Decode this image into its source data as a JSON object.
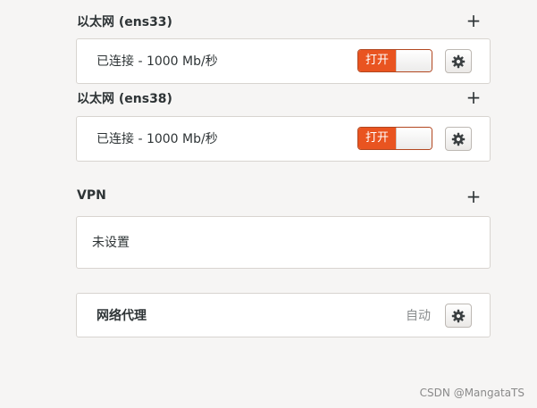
{
  "sections": [
    {
      "title": "以太网 (ens33)",
      "connection": {
        "status": "已连接 - 1000 Mb/秒",
        "toggle_label": "打开",
        "toggle_on": true
      }
    },
    {
      "title": "以太网 (ens38)",
      "connection": {
        "status": "已连接 - 1000 Mb/秒",
        "toggle_label": "打开",
        "toggle_on": true
      }
    }
  ],
  "vpn": {
    "title": "VPN",
    "status": "未设置"
  },
  "proxy": {
    "title": "网络代理",
    "mode": "自动"
  },
  "icons": {
    "add": "plus-icon",
    "settings": "gear-icon"
  },
  "colors": {
    "accent": "#e95420",
    "background": "#f6f5f4",
    "card": "#ffffff"
  },
  "watermark": "CSDN @MangataTS"
}
